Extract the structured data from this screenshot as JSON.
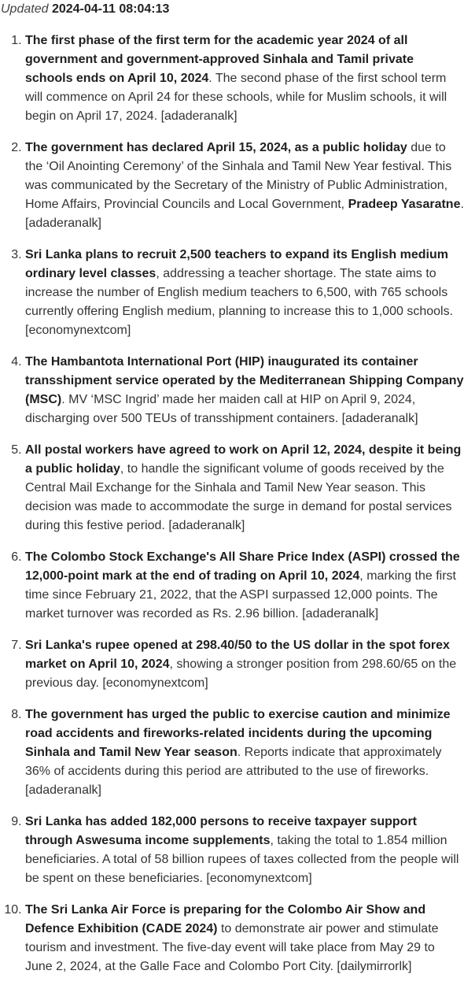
{
  "updated": {
    "label": "Updated",
    "timestamp": "2024-04-11 08:04:13"
  },
  "items": [
    {
      "head": "The first phase of the first term for the academic year 2024 of all government and government-approved Sinhala and Tamil private schools ends on April 10, 2024",
      "body": ". The second phase of the first school term will commence on April 24 for these schools, while for Muslim schools, it will begin on April 17, 2024. [adaderanalk]"
    },
    {
      "head": "The government has declared April 15, 2024, as a public holiday",
      "body": " due to the ‘Oil Anointing Ceremony’ of the Sinhala and Tamil New Year festival. This was communicated by the Secretary of the Ministry of Public Administration, Home Affairs, Provincial Councils and Local Government, ",
      "bold2": "Pradeep Yasaratne",
      "body2": ". [adaderanalk]"
    },
    {
      "head": "Sri Lanka plans to recruit 2,500 teachers to expand its English medium ordinary level classes",
      "body": ", addressing a teacher shortage. The state aims to increase the number of English medium teachers to 6,500, with 765 schools currently offering English medium, planning to increase this to 1,000 schools. [economynextcom]"
    },
    {
      "head": "The Hambantota International Port (HIP) inaugurated its container transshipment service operated by the Mediterranean Shipping Company (MSC)",
      "body": ". MV ‘MSC Ingrid’ made her maiden call at HIP on April 9, 2024, discharging over 500 TEUs of transshipment containers. [adaderanalk]"
    },
    {
      "head": "All postal workers have agreed to work on April 12, 2024, despite it being a public holiday",
      "body": ", to handle the significant volume of goods received by the Central Mail Exchange for the Sinhala and Tamil New Year season. This decision was made to accommodate the surge in demand for postal services during this festive period. [adaderanalk]"
    },
    {
      "head": "The Colombo Stock Exchange's All Share Price Index (ASPI) crossed the 12,000-point mark at the end of trading on April 10, 2024",
      "body": ", marking the first time since February 21, 2022, that the ASPI surpassed 12,000 points. The market turnover was recorded as Rs. 2.96 billion. [adaderanalk]"
    },
    {
      "head": "Sri Lanka's rupee opened at 298.40/50 to the US dollar in the spot forex market on April 10, 2024",
      "body": ", showing a stronger position from 298.60/65 on the previous day. [economynextcom]"
    },
    {
      "head": "The government has urged the public to exercise caution and minimize road accidents and fireworks-related incidents during the upcoming Sinhala and Tamil New Year season",
      "body": ". Reports indicate that approximately 36% of accidents during this period are attributed to the use of fireworks. [adaderanalk]"
    },
    {
      "head": "Sri Lanka has added 182,000 persons to receive taxpayer support through Aswesuma income supplements",
      "body": ", taking the total to 1.854 million beneficiaries. A total of 58 billion rupees of taxes collected from the people will be spent on these beneficiaries. [economynextcom]"
    },
    {
      "head": "The Sri Lanka Air Force is preparing for the Colombo Air Show and Defence Exhibition (CADE 2024)",
      "body": " to demonstrate air power and stimulate tourism and investment. The five-day event will take place from May 29 to June 2, 2024, at the Galle Face and Colombo Port City. [dailymirrorlk]"
    }
  ]
}
